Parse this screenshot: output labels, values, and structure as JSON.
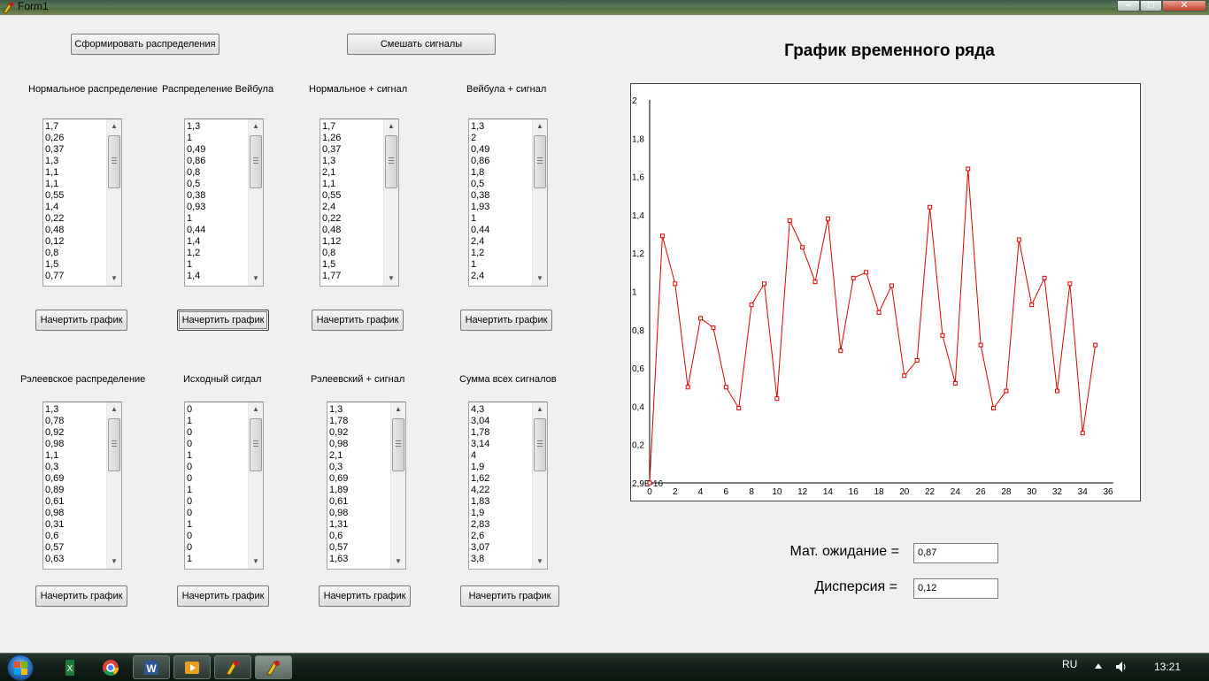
{
  "window": {
    "title": "Form1"
  },
  "buttons": {
    "generate": "Сформировать распределения",
    "mix": "Смешать сигналы",
    "plot": "Начертить график"
  },
  "lists": [
    {
      "label": "Нормальное распределение",
      "values": [
        "1,7",
        "0,26",
        "0,37",
        "1,3",
        "1,1",
        "1,1",
        "0,55",
        "1,4",
        "0,22",
        "0,48",
        "0,12",
        "0,8",
        "1,5",
        "0,77"
      ]
    },
    {
      "label": "Распределение Вейбула",
      "values": [
        "1,3",
        "1",
        "0,49",
        "0,86",
        "0,8",
        "0,5",
        "0,38",
        "0,93",
        "1",
        "0,44",
        "1,4",
        "1,2",
        "1",
        "1,4"
      ]
    },
    {
      "label": "Нормальное + сигнал",
      "values": [
        "1,7",
        "1,26",
        "0,37",
        "1,3",
        "2,1",
        "1,1",
        "0,55",
        "2,4",
        "0,22",
        "0,48",
        "1,12",
        "0,8",
        "1,5",
        "1,77"
      ]
    },
    {
      "label": "Вейбула + сигнал",
      "values": [
        "1,3",
        "2",
        "0,49",
        "0,86",
        "1,8",
        "0,5",
        "0,38",
        "1,93",
        "1",
        "0,44",
        "2,4",
        "1,2",
        "1",
        "2,4"
      ]
    },
    {
      "label": "Рэлеевское распределение",
      "values": [
        "1,3",
        "0,78",
        "0,92",
        "0,98",
        "1,1",
        "0,3",
        "0,69",
        "0,89",
        "0,61",
        "0,98",
        "0,31",
        "0,6",
        "0,57",
        "0,63"
      ]
    },
    {
      "label": "Исходный сигдал",
      "values": [
        "0",
        "1",
        "0",
        "0",
        "1",
        "0",
        "0",
        "1",
        "0",
        "0",
        "1",
        "0",
        "0",
        "1"
      ]
    },
    {
      "label": "Рэлеевский + сигнал",
      "values": [
        "1,3",
        "1,78",
        "0,92",
        "0,98",
        "2,1",
        "0,3",
        "0,69",
        "1,89",
        "0,61",
        "0,98",
        "1,31",
        "0,6",
        "0,57",
        "1,63"
      ]
    },
    {
      "label": "Сумма всех сигналов",
      "values": [
        "4,3",
        "3,04",
        "1,78",
        "3,14",
        "4",
        "1,9",
        "1,62",
        "4,22",
        "1,83",
        "1,9",
        "2,83",
        "2,6",
        "3,07",
        "3,8"
      ]
    }
  ],
  "chart_data": {
    "type": "line",
    "title": "График временного ряда",
    "x_ticks": [
      "0",
      "2",
      "4",
      "6",
      "8",
      "10",
      "12",
      "14",
      "16",
      "18",
      "20",
      "22",
      "24",
      "26",
      "28",
      "30",
      "32",
      "34",
      "36"
    ],
    "y_ticks": [
      "2,9E-16",
      "0,2",
      "0,4",
      "0,6",
      "0,8",
      "1",
      "1,2",
      "1,4",
      "1,6",
      "1,8",
      "2"
    ],
    "xlim": [
      0,
      36
    ],
    "ylim": [
      0,
      2
    ],
    "color": "#dd0000",
    "series": [
      {
        "x": [
          0,
          1,
          2,
          3,
          4,
          5,
          6,
          7,
          8,
          9,
          10,
          11,
          12,
          13,
          14,
          15,
          16,
          17,
          18,
          19,
          20,
          21,
          22,
          23,
          24,
          25,
          26,
          27,
          28,
          29,
          30,
          31,
          32,
          33,
          34,
          35
        ],
        "values": [
          0.0,
          1.29,
          1.04,
          0.5,
          0.86,
          0.81,
          0.5,
          0.39,
          0.93,
          1.04,
          0.44,
          1.37,
          1.23,
          1.05,
          1.38,
          0.69,
          1.07,
          1.1,
          0.89,
          1.03,
          0.56,
          0.64,
          1.44,
          0.77,
          0.52,
          1.64,
          0.72,
          0.39,
          0.48,
          1.27,
          0.93,
          1.07,
          0.48,
          1.04,
          0.26,
          0.72
        ]
      }
    ]
  },
  "stats": {
    "mean_label": "Мат. ожидание =",
    "mean_value": "0,87",
    "variance_label": "Дисперсия =",
    "variance_value": "0,12"
  },
  "taskbar": {
    "items": [
      "excel-icon",
      "chrome-icon",
      "word-icon",
      "media-player-icon",
      "delphi-icon",
      "delphi-icon"
    ],
    "lang": "RU",
    "time": "13:21"
  }
}
